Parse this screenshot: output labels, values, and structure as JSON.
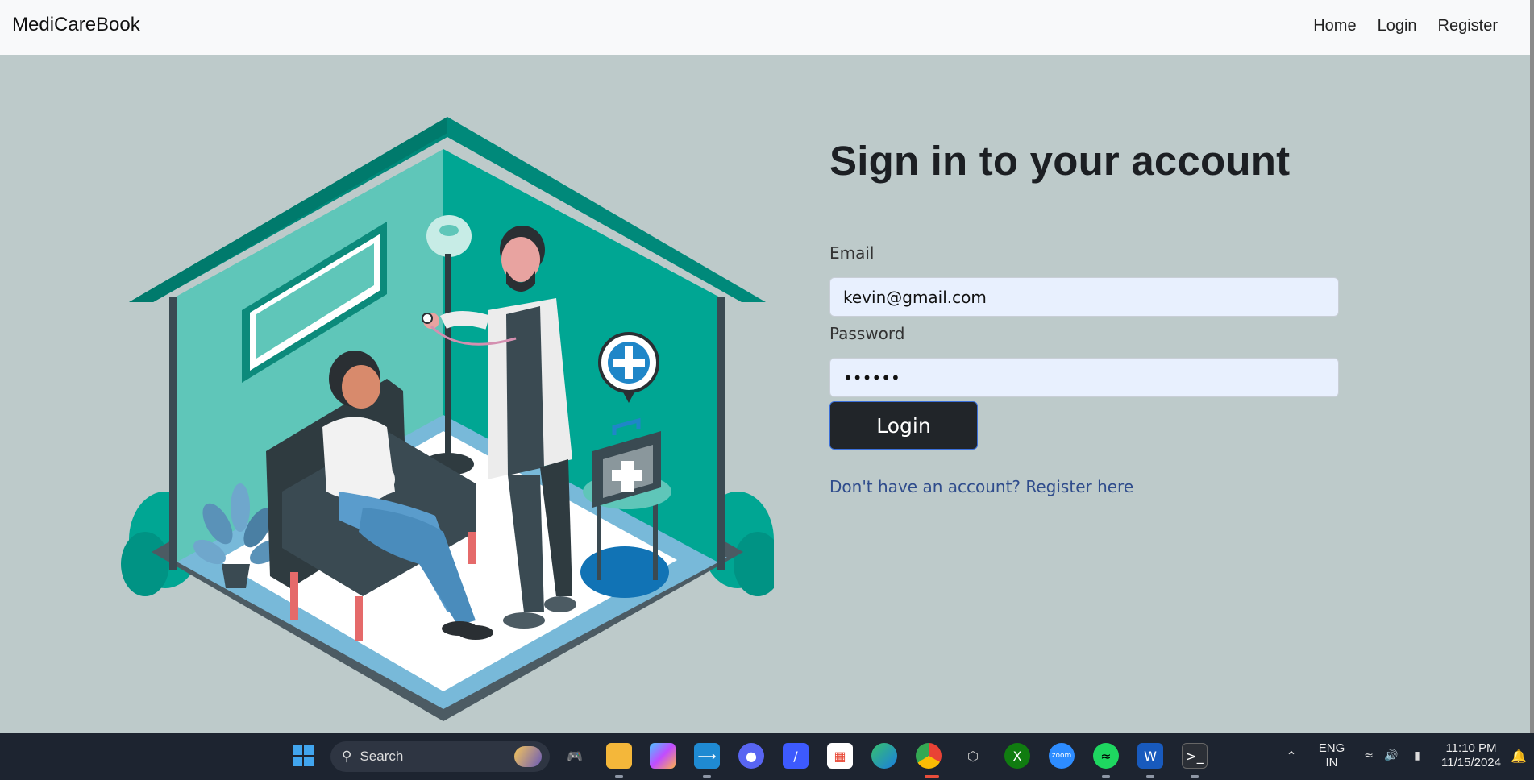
{
  "navbar": {
    "brand": "MediCareBook",
    "links": [
      "Home",
      "Login",
      "Register"
    ]
  },
  "form": {
    "title": "Sign in to your account",
    "email_label": "Email",
    "email_value": "kevin@gmail.com",
    "password_label": "Password",
    "password_value": "••••••",
    "login_button": "Login",
    "register_prompt": "Don't have an account? Register here"
  },
  "taskbar": {
    "search_label": "Search",
    "language": "ENG",
    "region": "IN",
    "time": "11:10 PM",
    "date": "11/15/2024",
    "apps": [
      "windows-start",
      "search",
      "game",
      "file-explorer",
      "copilot",
      "vscode",
      "discord",
      "visual-studio",
      "microsoft-store",
      "edge",
      "chrome",
      "unity",
      "xbox",
      "zoom",
      "spotify",
      "word",
      "terminal"
    ]
  },
  "colors": {
    "page_bg": "#bdcaca",
    "navbar_bg": "#f8f9fa",
    "button_bg": "#212529",
    "input_bg": "#e8f0fe",
    "link": "#2f4c8c",
    "teal": "#00a693"
  }
}
